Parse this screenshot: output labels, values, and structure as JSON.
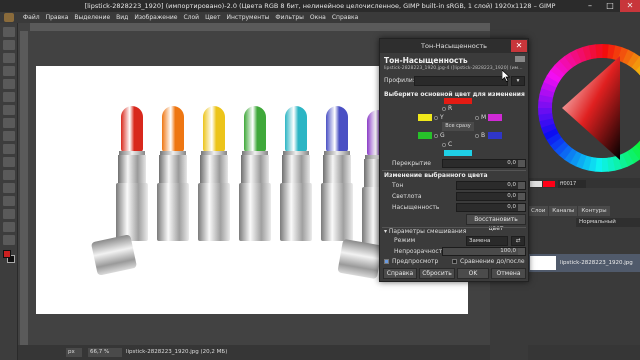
{
  "window": {
    "title": "[lipstick-2828223_1920] (импортировано)-2.0 (Цвета RGB 8 бит, нелинейное целочисленное, GIMP built-in sRGB, 1 слой) 1920x1128 – GIMP",
    "minimize": "–",
    "maximize": "□",
    "close": "✕"
  },
  "menu": [
    "Файл",
    "Правка",
    "Выделение",
    "Вид",
    "Изображение",
    "Слой",
    "Цвет",
    "Инструменты",
    "Фильтры",
    "Окна",
    "Справка"
  ],
  "image": {
    "lipstick_colors": [
      "#d8281c",
      "#ee7612",
      "#ecc41a",
      "#3fa83a",
      "#2cb5c4",
      "#4a50c4",
      "#8a3cc6"
    ]
  },
  "status": {
    "unit": "px",
    "zoom": "66,7 %",
    "file": "lipstick-2828223_1920.jpg (20,2 МБ)"
  },
  "dock": {
    "hex": "ff0017",
    "tabs": [
      "Слои",
      "Каналы",
      "Контуры"
    ],
    "mode": "Нормальный",
    "layer_name": "lipstick-2828223_1920.jpg",
    "swatch_colors": [
      "#e0e0e0",
      "#ff0017"
    ]
  },
  "dialog": {
    "title": "Тон-Насыщенность",
    "close": "✕",
    "heading": "Тон-Насыщенность",
    "subtitle": "lipstick-2828223_1920.jpg-4 ([lipstick-2828223_1920] (им...",
    "presets_label": "Профили:",
    "select_primary": "Выберите основной цвет для изменения",
    "primaries": {
      "R": "R",
      "Y": "Y",
      "G": "G",
      "C": "C",
      "B": "B",
      "M": "M"
    },
    "primary_colors": {
      "R": "#e41b13",
      "Y": "#f0e81a",
      "G": "#27c12a",
      "C": "#1fd0e6",
      "B": "#2f36c8",
      "M": "#d02ad6"
    },
    "all_button": "Все сразу",
    "overlap_label": "Перекрытие",
    "overlap_value": "0,0",
    "adjust_heading": "Изменение выбранного цвета",
    "hue_label": "Тон",
    "hue_value": "0,0",
    "lightness_label": "Светлота",
    "lightness_value": "0,0",
    "saturation_label": "Насыщенность",
    "saturation_value": "0,0",
    "reset_color": "Восстановить цвет",
    "blend_heading": "Параметры смешивания",
    "mode_label": "Режим",
    "mode_value": "Замена",
    "opacity_label": "Непрозрачность",
    "opacity_value": "100,0",
    "opacity_fraction": 1.0,
    "preview_label": "Предпросмотр",
    "split_label": "Сравнение до/после",
    "help_button": "Справка",
    "reset_button": "Сбросить",
    "ok_button": "OK",
    "cancel_button": "Отмена"
  }
}
